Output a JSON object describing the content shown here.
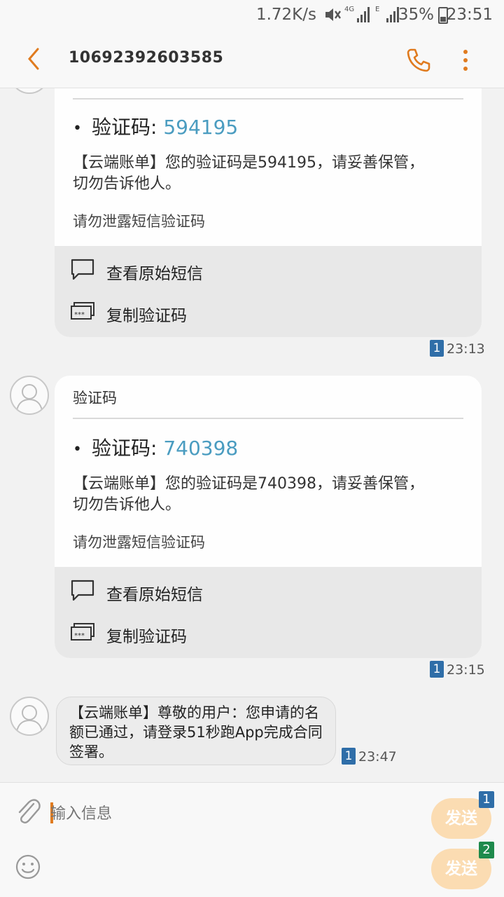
{
  "status_bar": {
    "net_speed": "1.72K/s",
    "net_4g": "4G",
    "net_e": "E",
    "battery": "35%",
    "time": "23:51"
  },
  "header": {
    "contact": "10692392603585"
  },
  "messages": [
    {
      "type": "otp_card",
      "title": "",
      "code_label": "验证码:",
      "code": "594195",
      "body": "【云端账单】您的验证码是594195，请妥善保管，切勿告诉他人。",
      "notice": "请勿泄露短信验证码",
      "actions": [
        {
          "label": "查看原始短信"
        },
        {
          "label": "复制验证码"
        }
      ],
      "sim": "1",
      "time": "23:13"
    },
    {
      "type": "otp_card",
      "title": "验证码",
      "code_label": "验证码:",
      "code": "740398",
      "body": "【云端账单】您的验证码是740398，请妥善保管，切勿告诉他人。",
      "notice": "请勿泄露短信验证码",
      "actions": [
        {
          "label": "查看原始短信"
        },
        {
          "label": "复制验证码"
        }
      ],
      "sim": "1",
      "time": "23:15"
    },
    {
      "type": "text",
      "body": "【云端账单】尊敬的用户：您申请的名额已通过，请登录51秒跑App完成合同签署。",
      "sim": "1",
      "time": "23:47"
    }
  ],
  "composer": {
    "placeholder": "输入信息",
    "send_buttons": [
      {
        "label": "发送",
        "sim": "1",
        "sim_color": "#2f6ea8"
      },
      {
        "label": "发送",
        "sim": "2",
        "sim_color": "#1e8a4c"
      }
    ]
  },
  "colors": {
    "accent": "#e07b1f",
    "code": "#4a9cc0",
    "send_bg": "#fbdcb2"
  }
}
